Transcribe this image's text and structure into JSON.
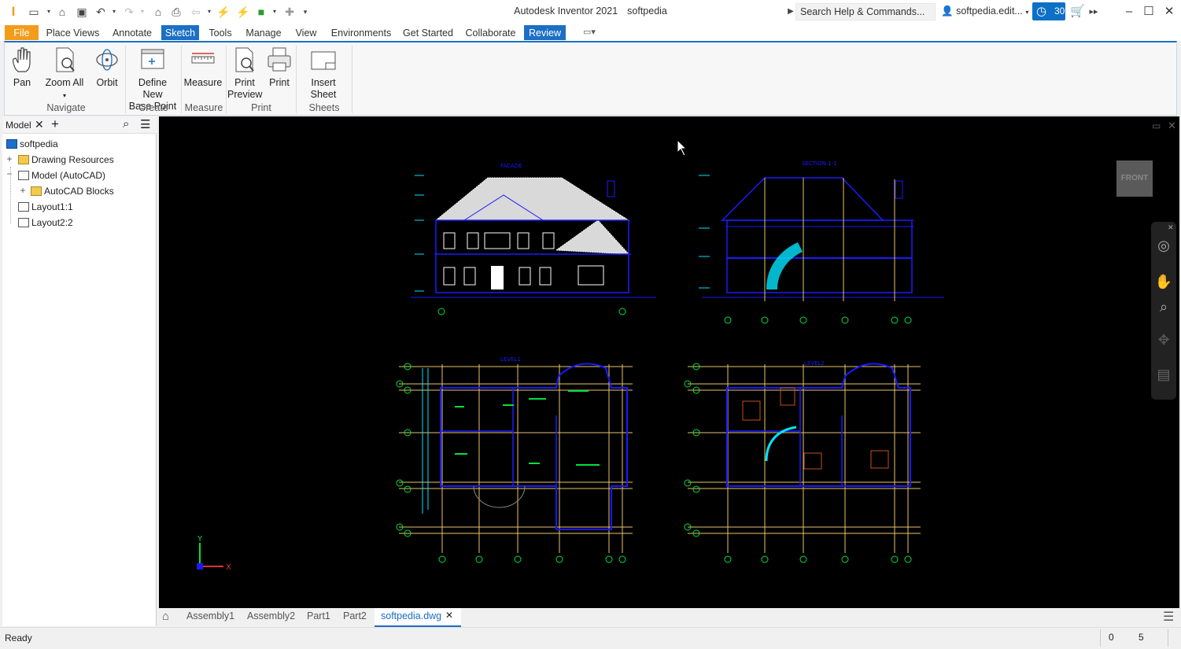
{
  "window": {
    "title": "Autodesk Inventor 2021",
    "document": "softpedia"
  },
  "search": {
    "placeholder": "Search Help & Commands..."
  },
  "user": {
    "name": "softpedia.edit..."
  },
  "timer": {
    "count": "30"
  },
  "tabs": [
    "File",
    "Place Views",
    "Annotate",
    "Sketch",
    "Tools",
    "Manage",
    "View",
    "Environments",
    "Get Started",
    "Collaborate",
    "Review"
  ],
  "ribbon": {
    "buttons": {
      "pan": "Pan",
      "zoom_all": "Zoom All",
      "orbit": "Orbit",
      "define_new_l1": "Define New",
      "define_new_l2": "Base Point",
      "measure": "Measure",
      "print_preview_l1": "Print",
      "print_preview_l2": "Preview",
      "print": "Print",
      "insert_sheet": "Insert Sheet"
    },
    "panels": {
      "navigate": "Navigate",
      "create": "Create",
      "measure": "Measure",
      "print": "Print",
      "sheets": "Sheets"
    }
  },
  "browser": {
    "title": "Model",
    "tree": {
      "root": "softpedia",
      "drawing_resources": "Drawing Resources",
      "model_autocad": "Model (AutoCAD)",
      "autocad_blocks": "AutoCAD Blocks",
      "layout1": "Layout1:1",
      "layout2": "Layout2:2"
    }
  },
  "viewcube": {
    "label": "FRONT"
  },
  "drawing": {
    "facade_label": "FACADE",
    "section_label": "SECTION 1-1",
    "level1_label": "LEVEL1",
    "level2_label": "LEVEL2",
    "axis_x": "X",
    "axis_y": "Y"
  },
  "doc_tabs": [
    "Assembly1",
    "Assembly2",
    "Part1",
    "Part2",
    "softpedia.dwg"
  ],
  "status": {
    "text": "Ready",
    "value1": "0",
    "value2": "5"
  },
  "colors": {
    "accent": "#1c6fc4",
    "file_tab": "#f39c1a",
    "cad_blue": "#1a1aff",
    "cad_yellow": "#e8c46a",
    "cad_green": "#00e040",
    "cad_cyan": "#00e5ff"
  }
}
